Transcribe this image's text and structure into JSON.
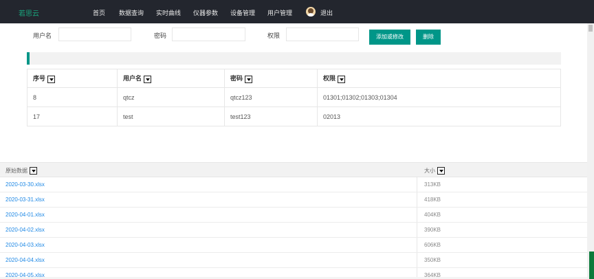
{
  "nav": {
    "brand": "若思云",
    "items": [
      "首页",
      "数据查询",
      "实时曲线",
      "仪器参数",
      "设备管理",
      "用户管理"
    ],
    "logout": "退出"
  },
  "form": {
    "username_label": "用户名",
    "password_label": "密码",
    "permission_label": "权限",
    "username_value": "",
    "password_value": "",
    "permission_value": "",
    "add_button": "添加或修改",
    "delete_button": "删除"
  },
  "users_table": {
    "headers": [
      "序号",
      "用户名",
      "密码",
      "权限"
    ],
    "rows": [
      [
        "8",
        "qtcz",
        "qtcz123",
        "01301;01302;01303;01304"
      ],
      [
        "17",
        "test",
        "test123",
        "02013"
      ]
    ]
  },
  "files": {
    "header_name": "原始数据",
    "header_size": "大小",
    "rows": [
      {
        "name": "2020-03-30.xlsx",
        "size": "313KB"
      },
      {
        "name": "2020-03-31.xlsx",
        "size": "418KB"
      },
      {
        "name": "2020-04-01.xlsx",
        "size": "404KB"
      },
      {
        "name": "2020-04-02.xlsx",
        "size": "390KB"
      },
      {
        "name": "2020-04-03.xlsx",
        "size": "606KB"
      },
      {
        "name": "2020-04-04.xlsx",
        "size": "350KB"
      },
      {
        "name": "2020-04-05.xlsx",
        "size": "364KB"
      }
    ]
  },
  "colors": {
    "accent": "#009688",
    "nav_bg": "#23262e",
    "link": "#1e88e5"
  }
}
